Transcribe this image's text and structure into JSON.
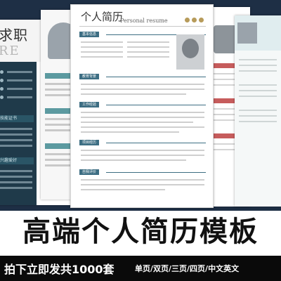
{
  "banner": {
    "title": "高端个人简历模板",
    "subtitle_main": "拍下立即发共1000套",
    "subtitle_tags": "单页/双页/三页/四页/中文英文"
  },
  "templates": {
    "left_card": {
      "heading": "求职",
      "heading_en": "RE",
      "sections": [
        "技能证书",
        "兴趣爱好"
      ]
    },
    "main_card": {
      "title": "个人简历",
      "title_en": "Personal resume",
      "sections": [
        "基本信息",
        "教育背景",
        "工作经验",
        "项目经历",
        "自我评价"
      ]
    }
  },
  "colors": {
    "stage_bg": "#1e2f45",
    "accent_teal": "#3d6e83",
    "accent_red": "#c65c5c",
    "banner_bar": "#0a0a0a"
  }
}
